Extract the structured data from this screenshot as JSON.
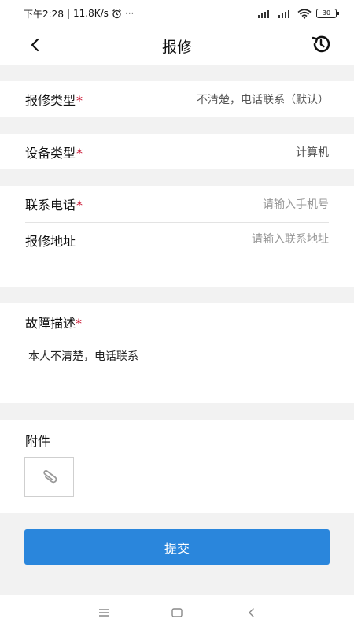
{
  "status_bar": {
    "time": "下午2:28",
    "speed": "11.8K/s",
    "more": "···",
    "battery": "30"
  },
  "header": {
    "title": "报修"
  },
  "form": {
    "repair_type": {
      "label": "报修类型",
      "required": "*",
      "value": "不清楚，电话联系（默认）"
    },
    "device_type": {
      "label": "设备类型",
      "required": "*",
      "value": "计算机"
    },
    "phone": {
      "label": "联系电话",
      "required": "*",
      "placeholder": "请输入手机号"
    },
    "address": {
      "label": "报修地址",
      "placeholder": "请输入联系地址"
    },
    "fault": {
      "label": "故障描述",
      "required": "*",
      "value": "本人不清楚，电话联系"
    },
    "attachment": {
      "label": "附件"
    }
  },
  "submit_label": "提交",
  "colors": {
    "accent": "#2a86dc",
    "required": "#c8102e",
    "background": "#f2f2f2"
  },
  "icons": [
    "back-arrow-icon",
    "history-icon",
    "paperclip-icon",
    "alarm-icon",
    "wifi-icon",
    "signal-icon",
    "battery-icon",
    "menu-icon",
    "home-icon",
    "back-nav-icon"
  ]
}
